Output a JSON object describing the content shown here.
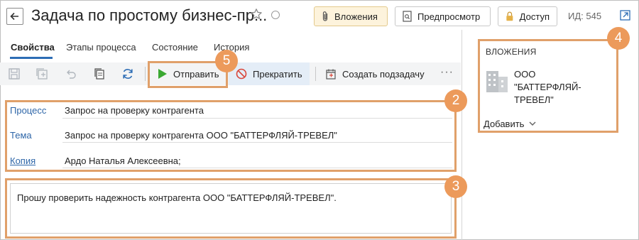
{
  "header": {
    "title": "Задача по простому бизнес-пр...",
    "attachments_btn": "Вложения",
    "preview_btn": "Предпросмотр",
    "access_btn": "Доступ",
    "id_text": "ИД: 545"
  },
  "tabs": [
    {
      "label": "Свойства"
    },
    {
      "label": "Этапы процесса"
    },
    {
      "label": "Состояние"
    },
    {
      "label": "История"
    }
  ],
  "toolbar": {
    "send_label": "Отправить",
    "cancel_label": "Прекратить",
    "subtask_label": "Создать подзадачу",
    "more_label": "···"
  },
  "fields": {
    "process_label": "Процесс",
    "process_value": "Запрос на проверку контрагента",
    "subject_label": "Тема",
    "subject_value": "Запрос на проверку контрагента ООО \"БАТТЕРФЛЯЙ-ТРЕВЕЛ\"",
    "copy_label": "Копия",
    "copy_value": "Ардо Наталья Алексеевна;"
  },
  "message": {
    "text": "Прошу проверить надежность контрагента ООО \"БАТТЕРФЛЯЙ-ТРЕВЕЛ\"."
  },
  "attachments": {
    "header": "ВЛОЖЕНИЯ",
    "item_name": "ООО \"БАТТЕРФЛЯЙ-ТРЕВЕЛ\"",
    "add_label": "Добавить"
  },
  "badges": {
    "b2": "2",
    "b3": "3",
    "b4": "4",
    "b5": "5"
  },
  "colors": {
    "accent": "#2d6db5",
    "highlight": "#e0a06a",
    "badge": "#ec9a5b",
    "play_green": "#3aa832",
    "stop_red": "#d9473b"
  }
}
